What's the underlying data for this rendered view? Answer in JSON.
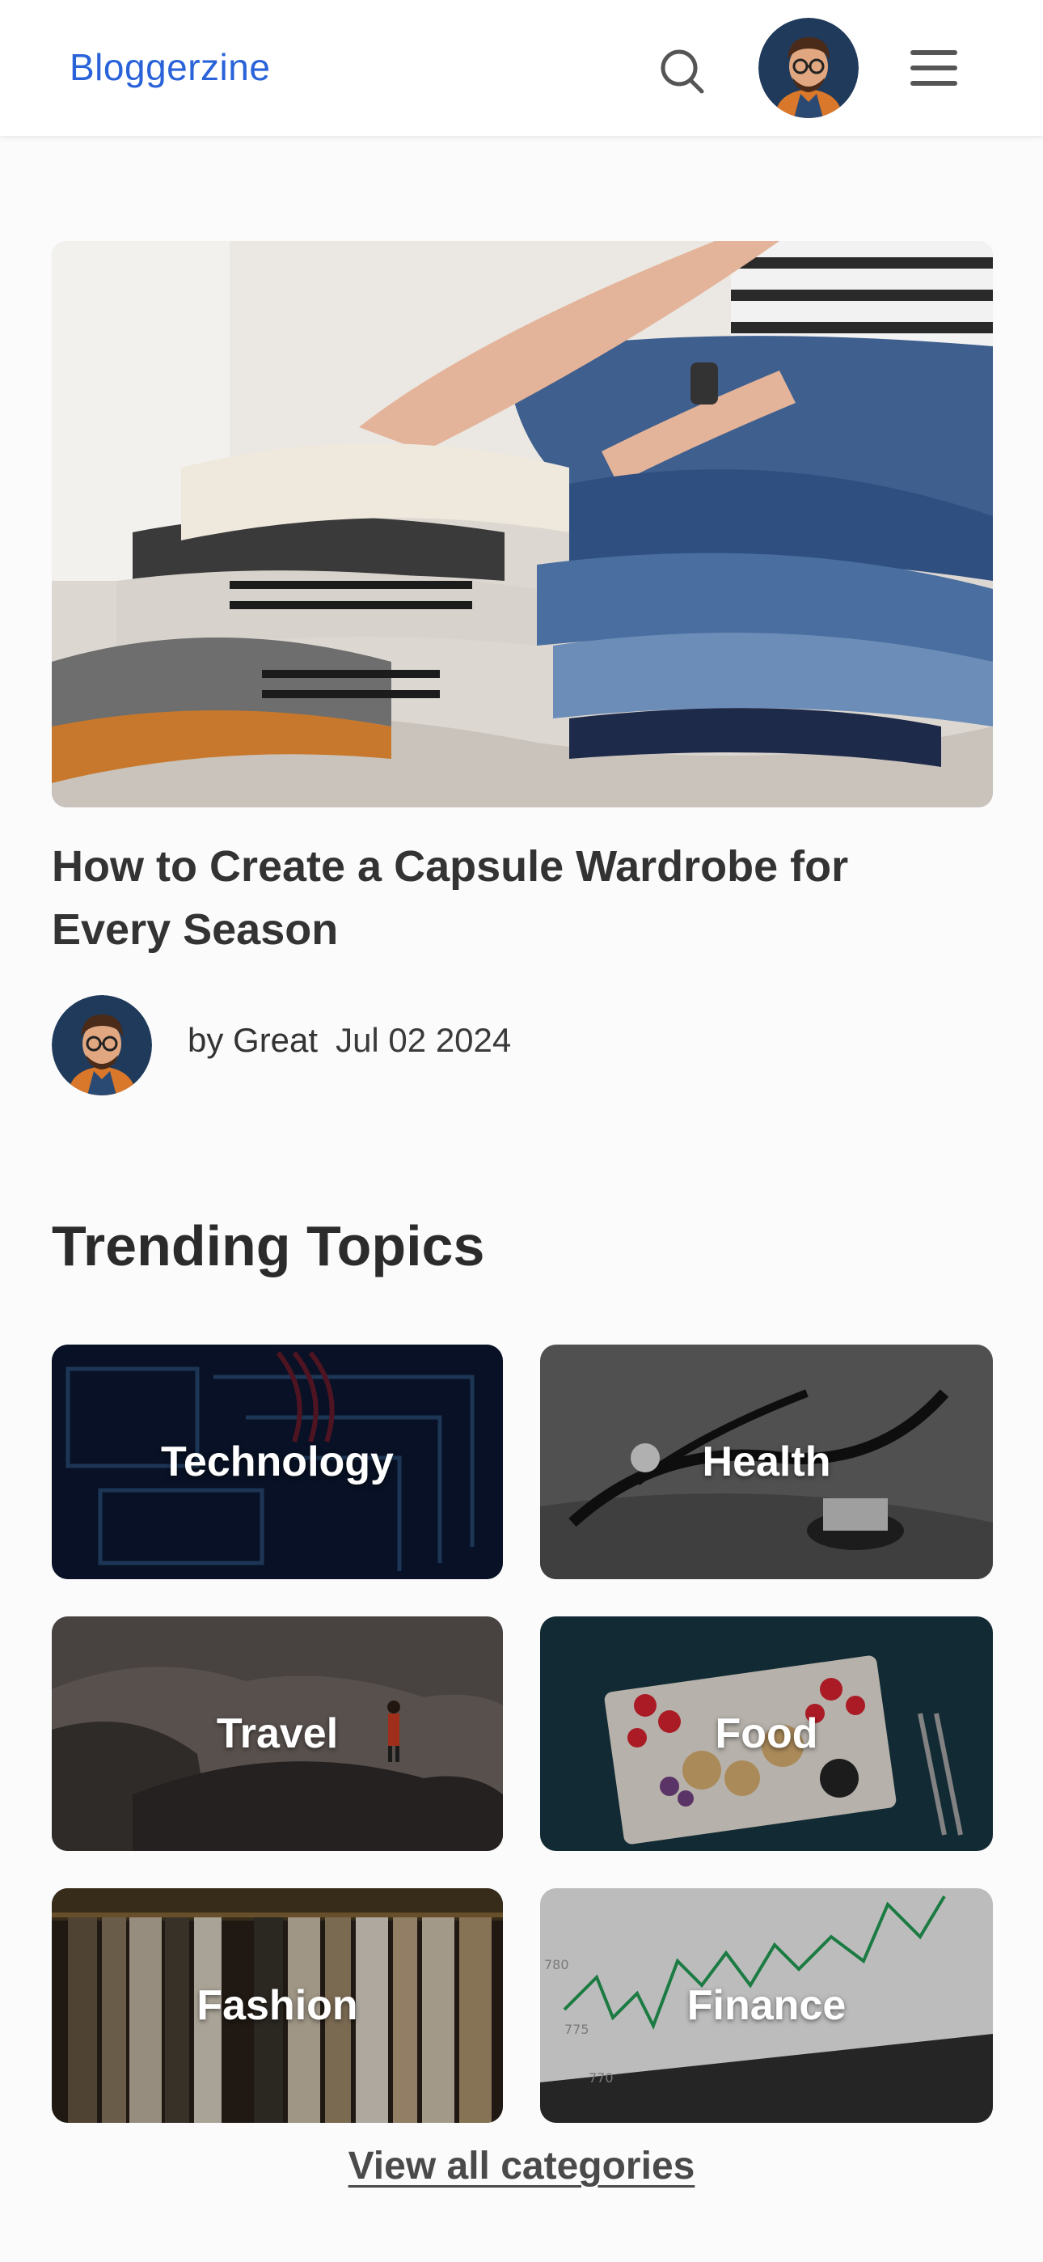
{
  "header": {
    "logo": "Bloggerzine",
    "search_icon": "search-icon",
    "avatar_icon": "user-avatar",
    "menu_icon": "hamburger-menu-icon"
  },
  "featured_post": {
    "image": "folded-clothes-photo",
    "title": "How to Create a Capsule Wardrobe for Every Season",
    "author": "by Great",
    "date": "Jul 02 2024"
  },
  "trending": {
    "title": "Trending Topics",
    "topics": [
      {
        "label": "Technology"
      },
      {
        "label": "Health"
      },
      {
        "label": "Travel"
      },
      {
        "label": "Food"
      },
      {
        "label": "Fashion"
      },
      {
        "label": "Finance"
      }
    ],
    "view_all": "View all categories"
  },
  "colors": {
    "brand": "#2962d9",
    "text": "#333333",
    "background": "#fbfbfc"
  }
}
